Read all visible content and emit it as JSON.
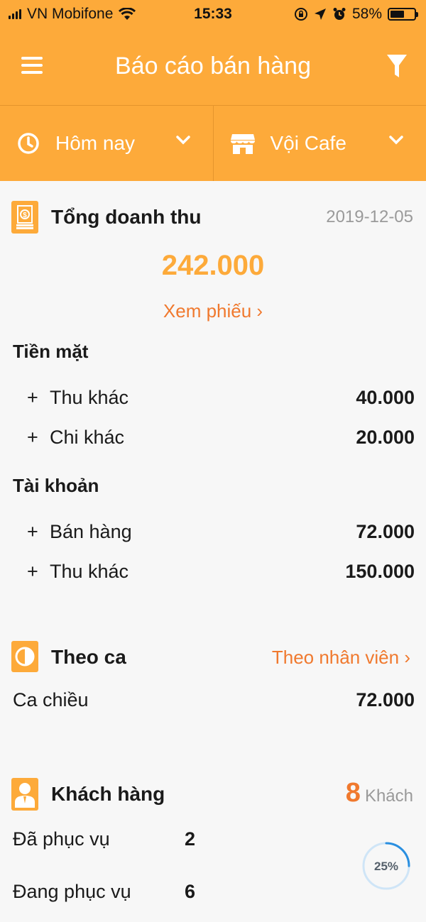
{
  "status_bar": {
    "carrier": "VN Mobifone",
    "time": "15:33",
    "battery": "58%",
    "battery_level": 0.58
  },
  "header": {
    "title": "Báo cáo bán hàng"
  },
  "selectors": {
    "period": "Hôm nay",
    "store": "Vội Cafe"
  },
  "revenue": {
    "title": "Tổng doanh thu",
    "date": "2019-12-05",
    "total": "242.000",
    "view_link": "Xem phiếu ›",
    "cash": {
      "title": "Tiền mặt",
      "items": [
        {
          "label": "Thu khác",
          "value": "40.000"
        },
        {
          "label": "Chi khác",
          "value": "20.000"
        }
      ]
    },
    "account": {
      "title": "Tài khoản",
      "items": [
        {
          "label": "Bán hàng",
          "value": "72.000"
        },
        {
          "label": "Thu khác",
          "value": "150.000"
        }
      ]
    }
  },
  "shift": {
    "title": "Theo ca",
    "link": "Theo nhân viên ›",
    "items": [
      {
        "label": "Ca chiều",
        "value": "72.000"
      }
    ]
  },
  "customers": {
    "title": "Khách hàng",
    "count": "8",
    "count_unit": "Khách",
    "served_label": "Đã phục vụ",
    "served_value": "2",
    "serving_label": "Đang phục vụ",
    "serving_value": "6",
    "percent_label": "25%",
    "percent": 0.25
  },
  "colors": {
    "accent": "#fdaa3a",
    "highlight": "#f0792e",
    "muted": "#9a9a9a"
  }
}
